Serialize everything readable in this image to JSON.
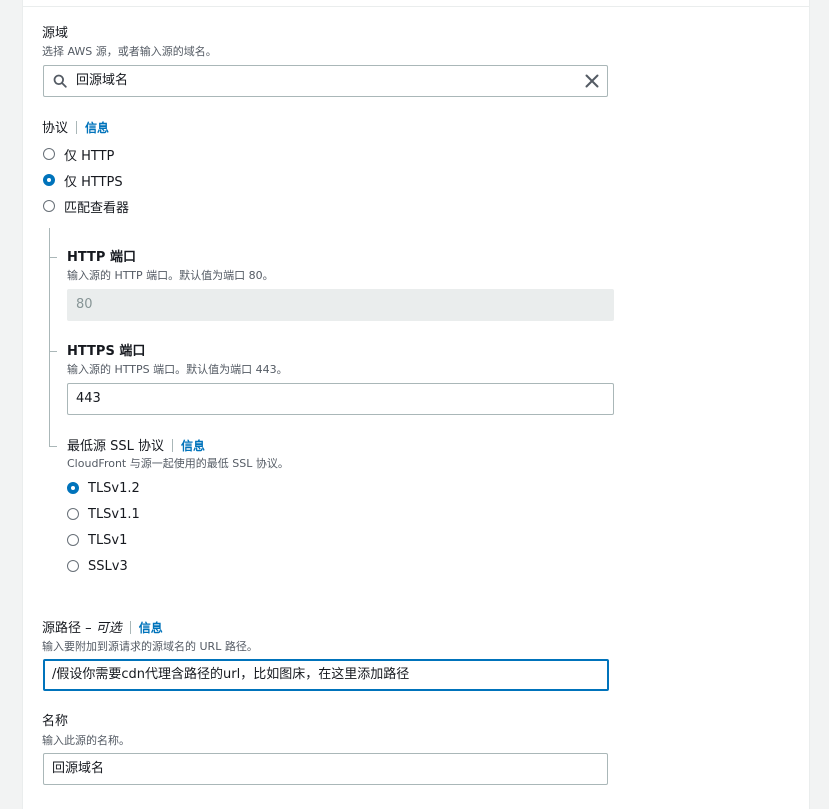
{
  "origin_domain": {
    "label": "源域",
    "description": "选择 AWS 源，或者输入源的域名。",
    "value": "回源域名"
  },
  "protocol": {
    "label": "协议",
    "info": "信息",
    "options": [
      "仅 HTTP",
      "仅 HTTPS",
      "匹配查看器"
    ],
    "selected": "仅 HTTPS"
  },
  "http_port": {
    "label": "HTTP 端口",
    "description": "输入源的 HTTP 端口。默认值为端口 80。",
    "value": "80"
  },
  "https_port": {
    "label": "HTTPS 端口",
    "description": "输入源的 HTTPS 端口。默认值为端口 443。",
    "value": "443"
  },
  "ssl_protocol": {
    "label": "最低源 SSL 协议",
    "info": "信息",
    "description": "CloudFront 与源一起使用的最低 SSL 协议。",
    "options": [
      "TLSv1.2",
      "TLSv1.1",
      "TLSv1",
      "SSLv3"
    ],
    "selected": "TLSv1.2"
  },
  "origin_path": {
    "label": "源路径 –",
    "optional": "可选",
    "info": "信息",
    "description": "输入要附加到源请求的源域名的 URL 路径。",
    "value": "/假设你需要cdn代理含路径的url，比如图床，在这里添加路径"
  },
  "name": {
    "label": "名称",
    "description": "输入此源的名称。",
    "value": "回源域名"
  },
  "colors": {
    "accent": "#0073bb",
    "border": "#aab7b8",
    "text": "#16191f",
    "secondary_text": "#545b64"
  },
  "icons": [
    "search-icon",
    "clear-icon",
    "radio-icon"
  ]
}
